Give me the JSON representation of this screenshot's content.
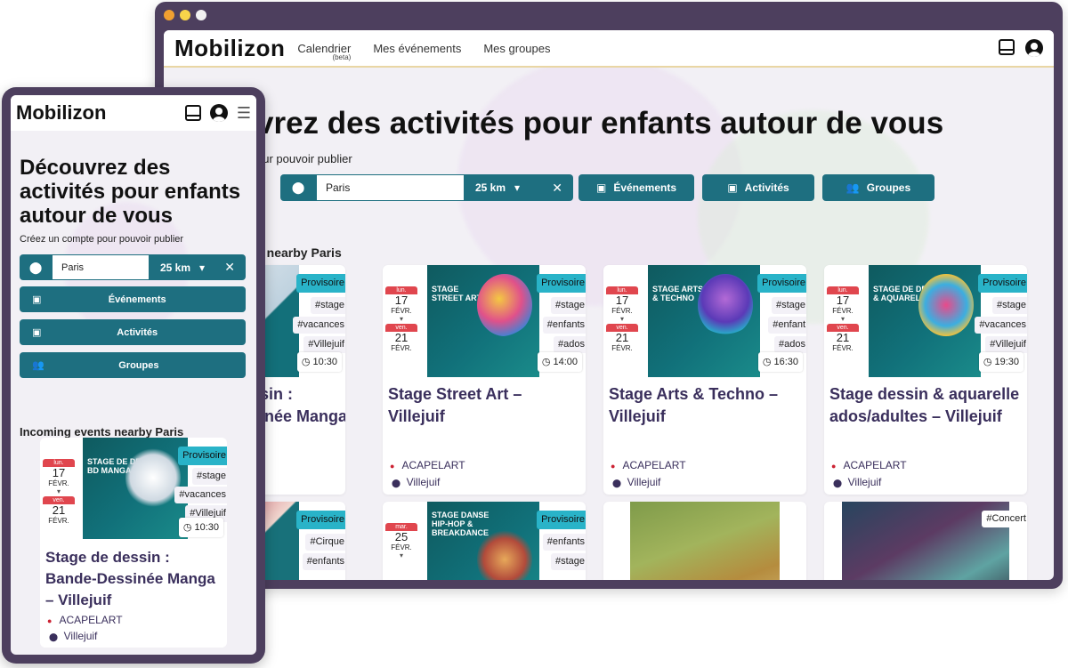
{
  "desktop": {
    "logo": "Mobilizon",
    "nav": [
      {
        "label": "Calendrier",
        "sub": "(beta)"
      },
      {
        "label": "Mes événements"
      },
      {
        "label": "Mes groupes"
      }
    ],
    "hero": "vrez des activités pour enfants autour de vous",
    "subline": "our pouvoir publier",
    "search": {
      "city": "Paris",
      "radius": "25 km"
    },
    "type_buttons": [
      "Événements",
      "Activités",
      "Groupes"
    ],
    "section_title": "s nearby Paris",
    "cards": [
      {
        "poster_title": "",
        "tags": [
          "Provisoire",
          "#stage",
          "#vacances",
          "#Villejuif"
        ],
        "time": "10:30",
        "title": "essin :\nssinée Manga",
        "org": "",
        "place": ""
      },
      {
        "poster_title": "STAGE\nSTREET ART",
        "date1": {
          "day": "lun.",
          "num": "17",
          "mon": "FÉVR."
        },
        "date2": {
          "day": "ven.",
          "num": "21",
          "mon": "FÉVR."
        },
        "tags": [
          "Provisoire",
          "#stage",
          "#enfants",
          "#ados"
        ],
        "time": "14:00",
        "title": "Stage Street Art – Villejuif",
        "org": "ACAPELART",
        "place": "Villejuif"
      },
      {
        "poster_title": "STAGE ARTS\n& TECHNO",
        "date1": {
          "day": "lun.",
          "num": "17",
          "mon": "FÉVR."
        },
        "date2": {
          "day": "ven.",
          "num": "21",
          "mon": "FÉVR."
        },
        "tags": [
          "Provisoire",
          "#stage",
          "#enfant",
          "#ados"
        ],
        "time": "16:30",
        "title": "Stage Arts & Techno – Villejuif",
        "org": "ACAPELART",
        "place": "Villejuif"
      },
      {
        "poster_title": "STAGE DE DESSIN\n& AQUARELLE",
        "date1": {
          "day": "lun.",
          "num": "17",
          "mon": "FÉVR."
        },
        "date2": {
          "day": "ven.",
          "num": "21",
          "mon": "FÉVR."
        },
        "tags": [
          "Provisoire",
          "#stage",
          "#vacances",
          "#Villejuif"
        ],
        "time": "19:30",
        "title": "Stage dessin & aquarelle ados/adultes – Villejuif",
        "org": "ACAPELART",
        "place": "Villejuif"
      }
    ],
    "cards_row2": [
      {
        "poster_title": "",
        "tags": [
          "Provisoire",
          "#Cirque",
          "#enfants"
        ]
      },
      {
        "poster_title": "STAGE DANSE\nHIP-HOP &\nBREAKDANCE",
        "date1": {
          "day": "mar.",
          "num": "25",
          "mon": "FÉVR."
        },
        "tags": [
          "Provisoire",
          "#enfants",
          "#stage"
        ]
      },
      {
        "poster_title": "",
        "tags": []
      },
      {
        "poster_title": "",
        "tags": [
          "#Concert"
        ]
      }
    ]
  },
  "phone": {
    "logo": "Mobilizon",
    "hero": "Découvrez des activités pour enfants autour de vous",
    "subline": "Créez un compte pour pouvoir publier",
    "search": {
      "city": "Paris",
      "radius": "25 km"
    },
    "buttons": [
      "Événements",
      "Activités",
      "Groupes"
    ],
    "section_title": "Incoming events nearby Paris",
    "card": {
      "poster_title": "STAGE DE DESSIN\nBD MANGA",
      "date1": {
        "day": "lun.",
        "num": "17",
        "mon": "FÉVR."
      },
      "date2": {
        "day": "ven.",
        "num": "21",
        "mon": "FÉVR."
      },
      "tags": [
        "Provisoire",
        "#stage",
        "#vacances",
        "#Villejuif"
      ],
      "time": "10:30",
      "title": "Stage de dessin : Bande-Dessinée Manga – Villejuif",
      "org": "ACAPELART",
      "place": "Villejuif"
    }
  }
}
